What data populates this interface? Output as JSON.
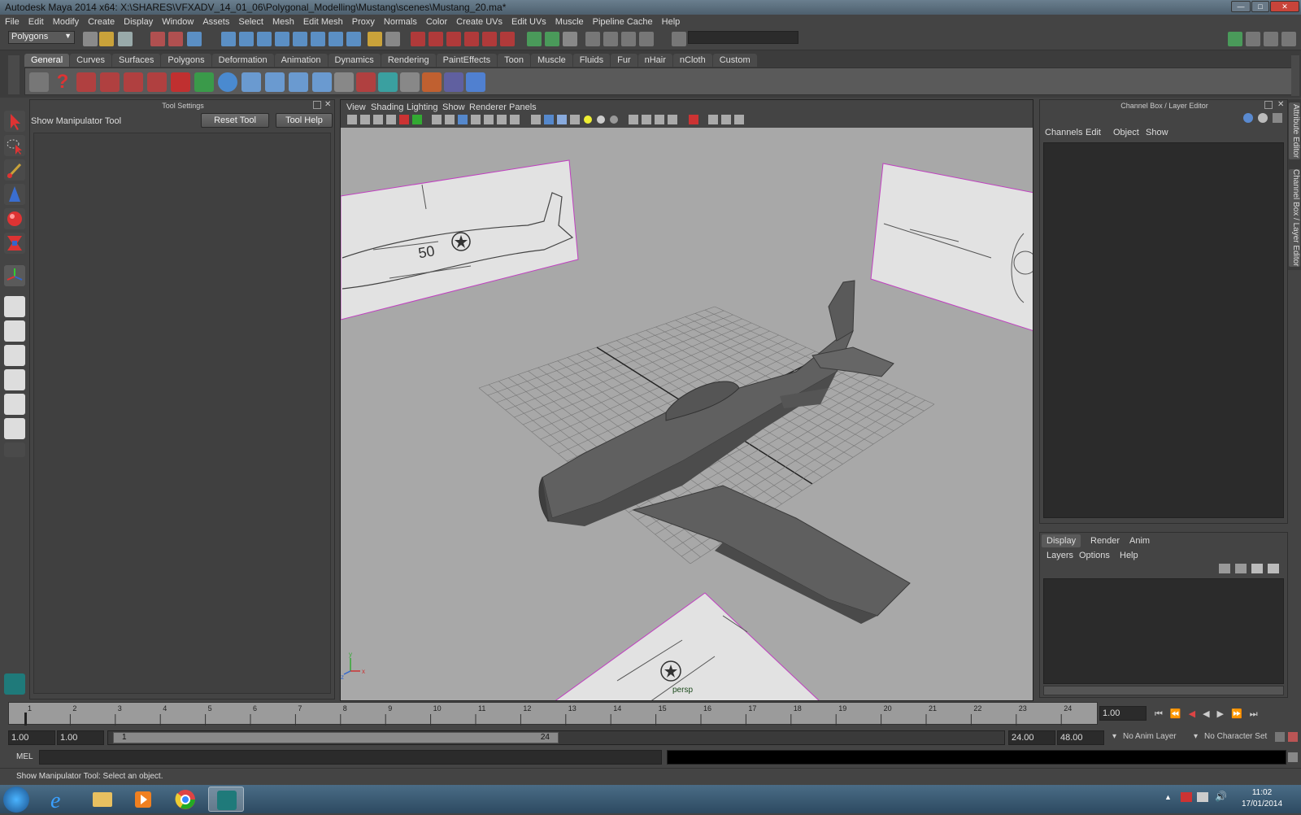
{
  "window": {
    "title": "Autodesk Maya 2014 x64: X:\\SHARES\\VFXADV_14_01_06\\Polygonal_Modelling\\Mustang\\scenes\\Mustang_20.ma*",
    "minimize_label": "—",
    "maximize_label": "□",
    "close_label": "✕"
  },
  "menubar": [
    "File",
    "Edit",
    "Modify",
    "Create",
    "Display",
    "Window",
    "Assets",
    "Select",
    "Mesh",
    "Edit Mesh",
    "Proxy",
    "Normals",
    "Color",
    "Create UVs",
    "Edit UVs",
    "Muscle",
    "Pipeline Cache",
    "Help"
  ],
  "statusline": {
    "menuset": "Polygons"
  },
  "shelf": {
    "tabs": [
      "General",
      "Curves",
      "Surfaces",
      "Polygons",
      "Deformation",
      "Animation",
      "Dynamics",
      "Rendering",
      "PaintEffects",
      "Toon",
      "Muscle",
      "Fluids",
      "Fur",
      "nHair",
      "nCloth",
      "Custom"
    ],
    "active_tab": "General"
  },
  "tool_settings": {
    "panel_title": "Tool Settings",
    "tool_name": "Show Manipulator Tool",
    "reset_label": "Reset Tool",
    "help_label": "Tool Help"
  },
  "viewport": {
    "menus": [
      "View",
      "Shading",
      "Lighting",
      "Show",
      "Renderer",
      "Panels"
    ],
    "camera_label": "persp",
    "ref_image_number": "50",
    "axis_x": "x",
    "axis_y": "y",
    "axis_z": "z"
  },
  "channel_box": {
    "title": "Channel Box / Layer Editor",
    "menus": [
      "Channels",
      "Edit",
      "Object",
      "Show"
    ]
  },
  "side_tabs": {
    "attribute_editor": "Attribute Editor",
    "channel_box": "Channel Box / Layer Editor"
  },
  "layer_editor": {
    "tabs": [
      "Display",
      "Render",
      "Anim"
    ],
    "active_tab": "Display",
    "menus": [
      "Layers",
      "Options",
      "Help"
    ]
  },
  "time_slider": {
    "ticks": [
      "1",
      "2",
      "3",
      "4",
      "5",
      "6",
      "7",
      "8",
      "9",
      "10",
      "11",
      "12",
      "13",
      "14",
      "15",
      "16",
      "17",
      "18",
      "19",
      "20",
      "21",
      "22",
      "23",
      "24"
    ],
    "current_time": "1.00"
  },
  "range_slider": {
    "start_time": "1.00",
    "playback_start": "1.00",
    "range_start_label": "1",
    "range_end_label": "24",
    "playback_end": "24.00",
    "end_time": "48.00",
    "anim_layer": "No Anim Layer",
    "character_set": "No Character Set"
  },
  "command_line": {
    "label": "MEL"
  },
  "help_line": {
    "text": "Show Manipulator Tool: Select an object."
  },
  "taskbar": {
    "time": "11:02",
    "date": "17/01/2014"
  },
  "colors": {
    "ui_bg": "#444444",
    "viewport_bg": "#a8a8a8",
    "title_bar": "#5a6e7d",
    "selection_magenta": "#c040c0"
  }
}
